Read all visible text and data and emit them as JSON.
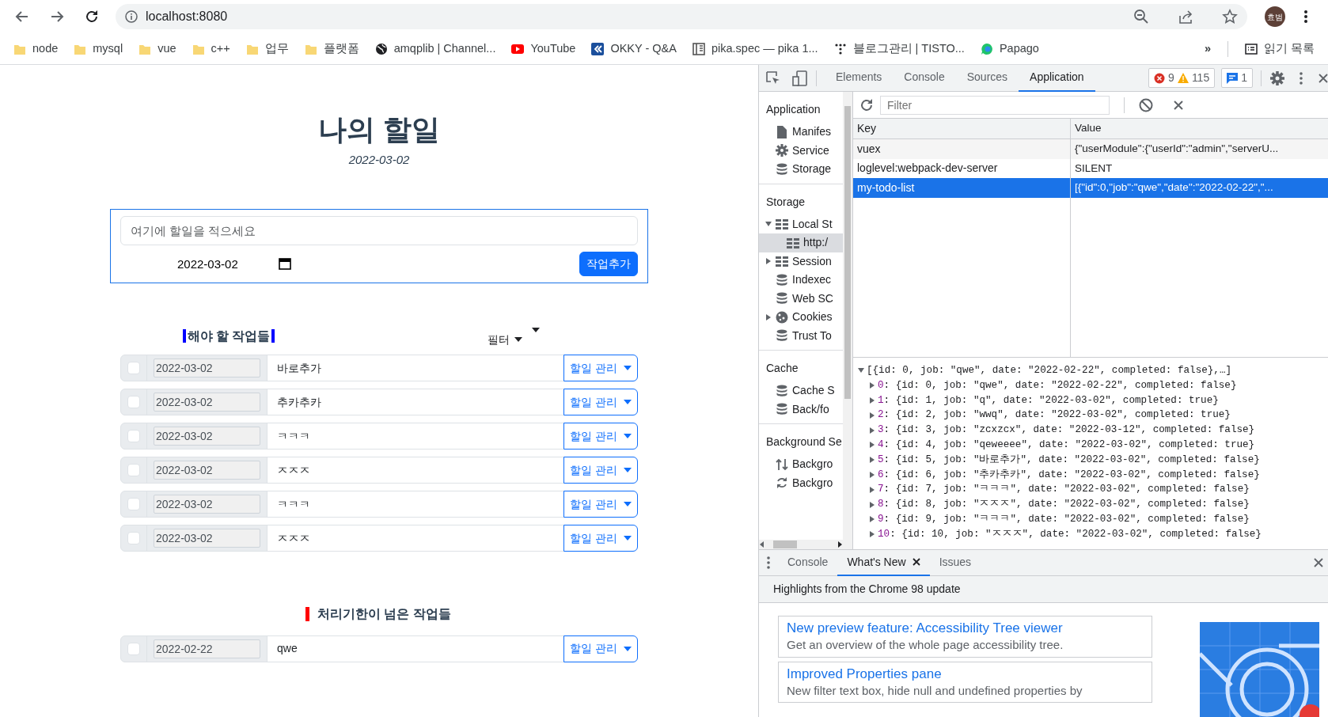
{
  "browser": {
    "address": "localhost:8080",
    "avatar": "효범",
    "bookmarks": [
      {
        "label": "node",
        "kind": "folder"
      },
      {
        "label": "mysql",
        "kind": "folder"
      },
      {
        "label": "vue",
        "kind": "folder"
      },
      {
        "label": "c++",
        "kind": "folder"
      },
      {
        "label": "업무",
        "kind": "folder"
      },
      {
        "label": "플랫폼",
        "kind": "folder"
      },
      {
        "label": "amqplib | Channel...",
        "kind": "globe"
      },
      {
        "label": "YouTube",
        "kind": "video"
      },
      {
        "label": "OKKY - Q&A",
        "kind": "chevron"
      },
      {
        "label": "pika.spec — pika 1...",
        "kind": "book"
      },
      {
        "label": "블로그관리 | TISTO...",
        "kind": "dots"
      },
      {
        "label": "Papago",
        "kind": "bubble"
      }
    ],
    "more": "»",
    "reading_list": "읽기 목록"
  },
  "app": {
    "title": "나의 할일",
    "date": "2022-03-02",
    "new_task": {
      "placeholder": "여기에 할일을 적으세요",
      "date": "2022-03-02",
      "button": "작업추가"
    },
    "todo_section": {
      "heading": "해야 할 작업들",
      "filter": "필터",
      "rows": [
        {
          "checked": false,
          "date": "2022-03-02",
          "job": "바로추가",
          "menu": "할일 관리"
        },
        {
          "checked": false,
          "date": "2022-03-02",
          "job": "추카추카",
          "menu": "할일 관리"
        },
        {
          "checked": false,
          "date": "2022-03-02",
          "job": "ㅋㅋㅋ",
          "menu": "할일 관리"
        },
        {
          "checked": false,
          "date": "2022-03-02",
          "job": "ㅈㅈㅈ",
          "menu": "할일 관리"
        },
        {
          "checked": false,
          "date": "2022-03-02",
          "job": "ㅋㅋㅋ",
          "menu": "할일 관리"
        },
        {
          "checked": false,
          "date": "2022-03-02",
          "job": "ㅈㅈㅈ",
          "menu": "할일 관리"
        }
      ]
    },
    "overdue_section": {
      "heading": "처리기한이 넘은 작업들",
      "rows": [
        {
          "checked": false,
          "date": "2022-02-22",
          "job": "qwe",
          "menu": "할일 관리"
        }
      ]
    }
  },
  "devtools": {
    "tabs": [
      {
        "label": "Elements",
        "selected": false
      },
      {
        "label": "Console",
        "selected": false
      },
      {
        "label": "Sources",
        "selected": false
      },
      {
        "label": "Application",
        "selected": true
      }
    ],
    "errors": "9",
    "warnings": "115",
    "messages": "1",
    "sidebar": [
      {
        "heading": "Application",
        "items": [
          {
            "label": "Manifes",
            "kind": "file",
            "selected": false
          },
          {
            "label": "Service",
            "kind": "gear",
            "selected": false
          },
          {
            "label": "Storage",
            "kind": "database",
            "selected": false
          }
        ]
      },
      {
        "heading": "Storage",
        "items": [
          {
            "label": "Local St",
            "kind": "table",
            "selected": false,
            "expanded": true,
            "children": [
              {
                "label": "http:/",
                "kind": "table",
                "selected": true
              }
            ]
          },
          {
            "label": "Session",
            "kind": "table",
            "selected": false,
            "expanded": false
          },
          {
            "label": "Indexec",
            "kind": "database",
            "selected": false
          },
          {
            "label": "Web SC",
            "kind": "database",
            "selected": false
          },
          {
            "label": "Cookies",
            "kind": "cookie",
            "selected": false,
            "expanded": false
          },
          {
            "label": "Trust To",
            "kind": "database",
            "selected": false
          }
        ]
      },
      {
        "heading": "Cache",
        "items": [
          {
            "label": "Cache S",
            "kind": "database",
            "selected": false
          },
          {
            "label": "Back/fo",
            "kind": "database",
            "selected": false
          }
        ]
      },
      {
        "heading": "Background Se",
        "items": [
          {
            "label": "Backgro",
            "kind": "arrows",
            "selected": false
          },
          {
            "label": "Backgro",
            "kind": "sync",
            "selected": false
          }
        ]
      }
    ],
    "filter_placeholder": "Filter",
    "storage_table": {
      "columns": [
        "Key",
        "Value"
      ],
      "rows": [
        {
          "key": "vuex",
          "value": "{\"userModule\":{\"userId\":\"admin\",\"serverU...",
          "selected": false
        },
        {
          "key": "loglevel:webpack-dev-server",
          "value": "SILENT",
          "selected": false
        },
        {
          "key": "my-todo-list",
          "value": "[{\"id\":0,\"job\":\"qwe\",\"date\":\"2022-02-22\",\"...",
          "selected": true
        }
      ]
    },
    "preview": {
      "summary": "[{id: 0, job: \"qwe\", date: \"2022-02-22\", completed: false},…]",
      "expanded": true,
      "items": [
        {
          "index": "0",
          "text": ": {id: 0, job: \"qwe\", date: \"2022-02-22\", completed: false}",
          "expanded": false
        },
        {
          "index": "1",
          "text": ": {id: 1, job: \"q\", date: \"2022-03-02\", completed: true}",
          "expanded": false
        },
        {
          "index": "2",
          "text": ": {id: 2, job: \"wwq\", date: \"2022-03-02\", completed: true}",
          "expanded": false
        },
        {
          "index": "3",
          "text": ": {id: 3, job: \"zcxzcx\", date: \"2022-03-12\", completed: false}",
          "expanded": false
        },
        {
          "index": "4",
          "text": ": {id: 4, job: \"qeweeee\", date: \"2022-03-02\", completed: true}",
          "expanded": false
        },
        {
          "index": "5",
          "text": ": {id: 5, job: \"바로추가\", date: \"2022-03-02\", completed: false}",
          "expanded": false
        },
        {
          "index": "6",
          "text": ": {id: 6, job: \"추카추카\", date: \"2022-03-02\", completed: false}",
          "expanded": false
        },
        {
          "index": "7",
          "text": ": {id: 7, job: \"ㅋㅋㅋ\", date: \"2022-03-02\", completed: false}",
          "expanded": false
        },
        {
          "index": "8",
          "text": ": {id: 8, job: \"ㅈㅈㅈ\", date: \"2022-03-02\", completed: false}",
          "expanded": false
        },
        {
          "index": "9",
          "text": ": {id: 9, job: \"ㅋㅋㅋ\", date: \"2022-03-02\", completed: false}",
          "expanded": false
        },
        {
          "index": "10",
          "text": ": {id: 10, job: \"ㅈㅈㅈ\", date: \"2022-03-02\", completed: false}",
          "expanded": false
        }
      ]
    },
    "drawer": {
      "tabs": [
        {
          "label": "Console",
          "selected": false,
          "closable": false
        },
        {
          "label": "What's New",
          "selected": true,
          "closable": true
        },
        {
          "label": "Issues",
          "selected": false,
          "closable": false
        }
      ],
      "heading": "Highlights from the Chrome 98 update",
      "cards": [
        {
          "title": "New preview feature: Accessibility Tree viewer",
          "description": "Get an overview of the whole page accessibility tree."
        },
        {
          "title": "Improved Properties pane",
          "description": "New filter text box, hide null and undefined properties by"
        }
      ]
    }
  }
}
